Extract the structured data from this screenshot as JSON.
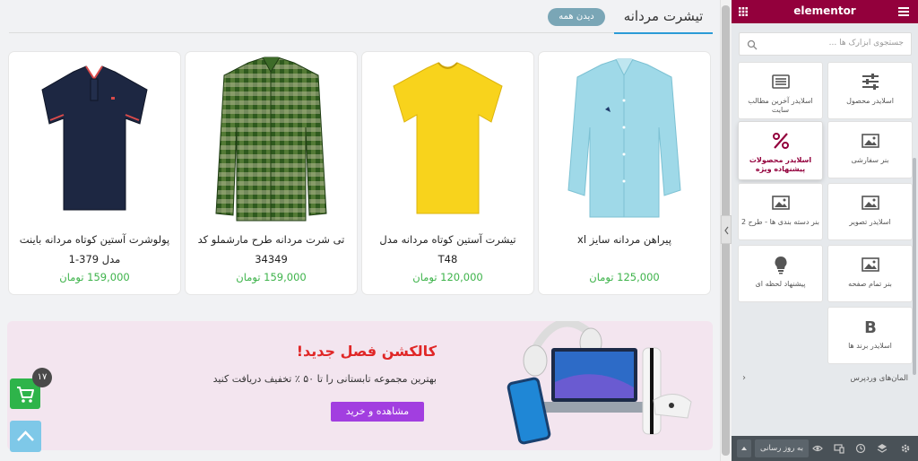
{
  "section": {
    "title": "تیشرت مردانه",
    "see_all": "دیدن همه"
  },
  "products": [
    {
      "name": "پیراهن مردانه سایز xl",
      "price": "125,000 تومان",
      "image": "light-blue-dress-shirt"
    },
    {
      "name": "تیشرت آستین کوتاه مردانه مدل T48",
      "price": "120,000 تومان",
      "image": "yellow-tshirt"
    },
    {
      "name": "تی شرت مردانه طرح مارشملو کد 34349",
      "price": "159,000 تومان",
      "image": "green-plaid-shirt"
    },
    {
      "name": "پولوشرت آستین کوتاه مردانه باینت مدل 379-1",
      "price": "159,000 تومان",
      "image": "navy-polo-shirt"
    }
  ],
  "banner": {
    "title": "کالکشن فصل جدید!",
    "text": "بهترین مجموعه تابستانی را تا ۵۰ ٪ تخفیف دریافت کنید",
    "button": "مشاهده و خرید"
  },
  "floating": {
    "cart_count": "۱۷"
  },
  "panel": {
    "logo": "elementor",
    "search_placeholder": "جستجوی ابزارک ها ...",
    "widgets": [
      {
        "label": "اسلایدر محصول",
        "icon": "sliders-icon"
      },
      {
        "label": "اسلایدر آخرین مطالب سایت",
        "icon": "list-icon"
      },
      {
        "label": "بنر سفارشی",
        "icon": "image-icon"
      },
      {
        "label": "اسلایدر محصولات پیشنهاده ویژه",
        "icon": "percent-icon",
        "active": true
      },
      {
        "label": "اسلایدر تصویر",
        "icon": "image-icon"
      },
      {
        "label": "بنر دسته بندی ها - طرح 2",
        "icon": "image-icon"
      },
      {
        "label": "بنر تمام صفحه",
        "icon": "image-icon"
      },
      {
        "label": "پیشنهاد لحظه ای",
        "icon": "lightbulb-icon"
      },
      {
        "label": "اسلایدر برند ها",
        "icon": "bold-b-icon"
      }
    ],
    "category": "المان‌های وردپرس",
    "update_button": "به روز رسانی"
  },
  "colors": {
    "elementor_brand": "#93003c",
    "price_green": "#3db34a",
    "banner_title_red": "#e02727",
    "banner_button_purple": "#a23ee0",
    "tab_underline_blue": "#2b9bd6"
  }
}
